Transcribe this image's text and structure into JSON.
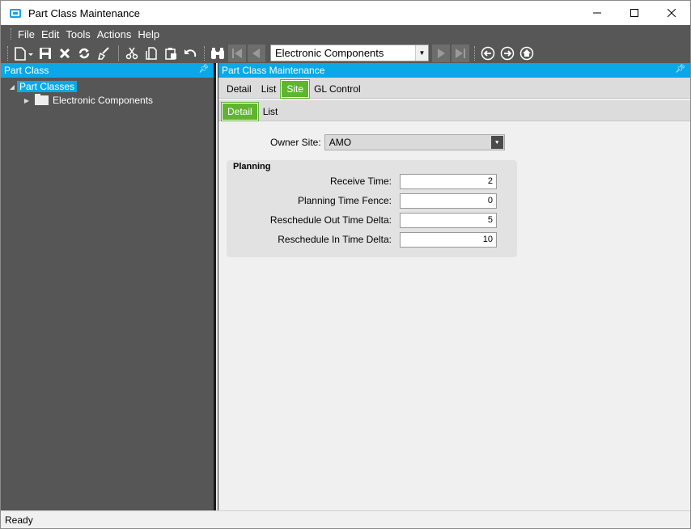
{
  "window": {
    "title": "Part Class Maintenance",
    "controls": {
      "minimize": "—",
      "maximize": "☐",
      "close": "✕"
    }
  },
  "menu": [
    "File",
    "Edit",
    "Tools",
    "Actions",
    "Help"
  ],
  "toolbar": {
    "buttons": [
      "new-icon",
      "save-icon",
      "delete-icon",
      "refresh-icon",
      "clear-icon",
      "cut-icon",
      "copy-icon",
      "paste-icon",
      "undo-icon",
      "binoculars-icon",
      "first-record-icon",
      "prev-record-icon",
      "next-record-icon",
      "last-record-icon",
      "back-icon",
      "forward-icon",
      "home-icon"
    ],
    "record_selector": "Electronic Components"
  },
  "left_panel": {
    "title": "Part Class",
    "tree": {
      "root": "Part Classes",
      "children": [
        "Electronic Components"
      ]
    }
  },
  "right_panel": {
    "title": "Part Class Maintenance",
    "tabs": [
      "Detail",
      "List",
      "Site",
      "GL Control"
    ],
    "active_tab": "Site",
    "subtabs": [
      "Detail",
      "List"
    ],
    "active_subtab": "Detail",
    "owner_site": {
      "label": "Owner Site:",
      "value": "AMO"
    },
    "planning": {
      "title": "Planning",
      "fields": [
        {
          "label": "Receive Time:",
          "value": "2"
        },
        {
          "label": "Planning Time Fence:",
          "value": "0"
        },
        {
          "label": "Reschedule Out Time Delta:",
          "value": "5"
        },
        {
          "label": "Reschedule In Time Delta:",
          "value": "10"
        }
      ]
    }
  },
  "status": {
    "text": "Ready"
  },
  "colors": {
    "accent_blue": "#0aa8e6",
    "tab_green": "#60b42f",
    "dark_bar": "#575757"
  }
}
